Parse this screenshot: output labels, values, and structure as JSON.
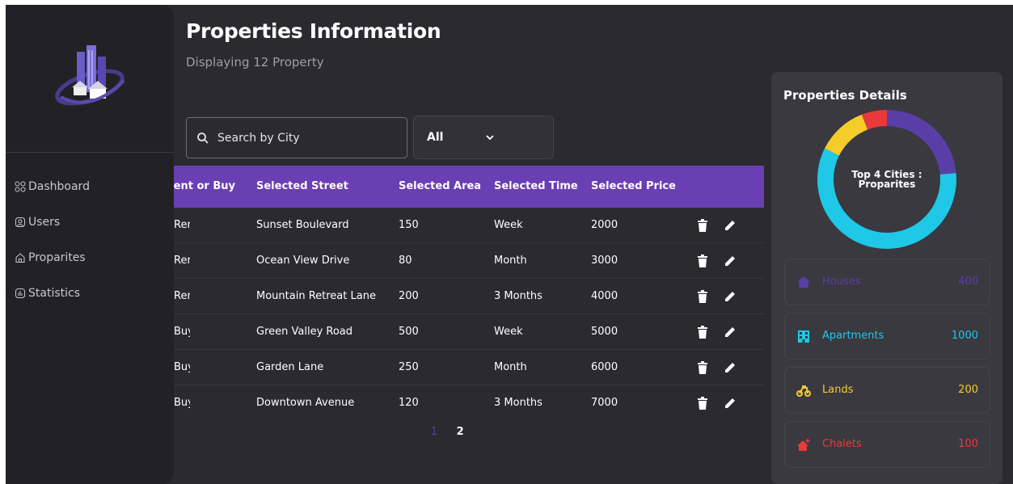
{
  "header": {
    "title": "Properties Information",
    "subtitle": "Displaying 12 Property"
  },
  "sidebar": {
    "items": [
      {
        "label": "Dashboard",
        "icon": "dashboard-icon"
      },
      {
        "label": "Users",
        "icon": "users-icon"
      },
      {
        "label": "Proparites",
        "icon": "home-icon"
      },
      {
        "label": "Statistics",
        "icon": "statistics-icon"
      }
    ]
  },
  "search": {
    "placeholder": "Search by City"
  },
  "filter": {
    "selected": "All"
  },
  "table": {
    "columns": [
      "Rent or Buy",
      "Selected Street",
      "Selected Area",
      "Selected Time",
      "Selected Price"
    ],
    "rows": [
      {
        "type": "Rent",
        "street": "Sunset Boulevard",
        "area": "150",
        "time": "Week",
        "price": "2000"
      },
      {
        "type": "Rent",
        "street": "Ocean View Drive",
        "area": "80",
        "time": "Month",
        "price": "3000"
      },
      {
        "type": "Rent",
        "street": "Mountain Retreat Lane",
        "area": "200",
        "time": "3 Months",
        "price": "4000"
      },
      {
        "type": "Buy",
        "street": "Green Valley Road",
        "area": "500",
        "time": "Week",
        "price": "5000"
      },
      {
        "type": "Buy",
        "street": "Garden Lane",
        "area": "250",
        "time": "Month",
        "price": "6000"
      },
      {
        "type": "Buy",
        "street": "Downtown Avenue",
        "area": "120",
        "time": "3 Months",
        "price": "7000"
      }
    ]
  },
  "pagination": {
    "pages": [
      "1",
      "2"
    ],
    "current": "1"
  },
  "details": {
    "title": "Properties Details",
    "donut_label_line1": "Top 4 Cities :",
    "donut_label_line2": "Proparites",
    "cards": [
      {
        "name": "Houses",
        "value": "400",
        "color": "#5a3ea8",
        "icon": "house-icon"
      },
      {
        "name": "Apartments",
        "value": "1000",
        "color": "#1ec8e6",
        "icon": "apartment-icon"
      },
      {
        "name": "Lands",
        "value": "200",
        "color": "#f5cc2a",
        "icon": "land-icon"
      },
      {
        "name": "Chalets",
        "value": "100",
        "color": "#e83a3a",
        "icon": "chalet-icon"
      }
    ]
  },
  "chart_data": {
    "type": "pie",
    "categories": [
      "Houses",
      "Apartments",
      "Lands",
      "Chalets"
    ],
    "values": [
      400,
      1000,
      200,
      100
    ],
    "colors": [
      "#5a3ea8",
      "#1ec8e6",
      "#f5cc2a",
      "#e83a3a"
    ],
    "title": "Top 4 Cities : Proparites"
  }
}
